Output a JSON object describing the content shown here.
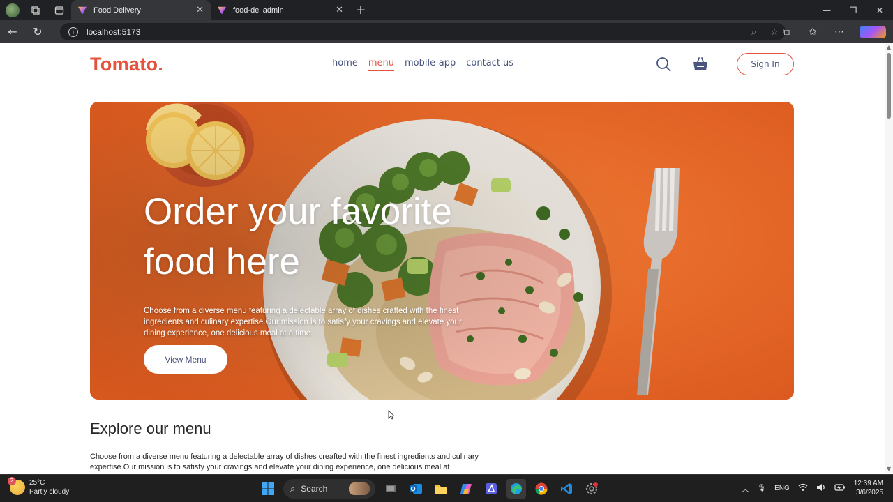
{
  "browser": {
    "tabs": [
      {
        "title": "Food Delivery",
        "active": true
      },
      {
        "title": "food-del admin",
        "active": false
      }
    ],
    "url": "localhost:5173"
  },
  "site": {
    "logo": "Tomato.",
    "nav": [
      "home",
      "menu",
      "mobile-app",
      "contact us"
    ],
    "active_nav": "menu",
    "signin_label": "Sign In",
    "accent": "#e5533d",
    "text_color": "#49557e"
  },
  "hero": {
    "title_line1": "Order your favorite",
    "title_line2": "food here",
    "text": "Choose from a diverse menu featuring a delectable array of dishes crafted with the finest ingredients and culinary expertise.Our mission is to satisfy your cravings and elevate your dining experience, one delicious meal at a time.",
    "button": "View Menu",
    "background": "#e8682a"
  },
  "explore": {
    "title": "Explore our menu",
    "text": "Choose from a diverse menu featuring a delectable array of dishes creafted with the finest ingredients and culinary expertise.Our mission is to satisfy your cravings and elevate your dining experience, one delicious meal at"
  },
  "taskbar": {
    "weather_temp": "25°C",
    "weather_desc": "Partly cloudy",
    "weather_badge": "2",
    "search_label": "Search",
    "lang": "ENG",
    "time": "12:39 AM",
    "date": "3/6/2025"
  }
}
